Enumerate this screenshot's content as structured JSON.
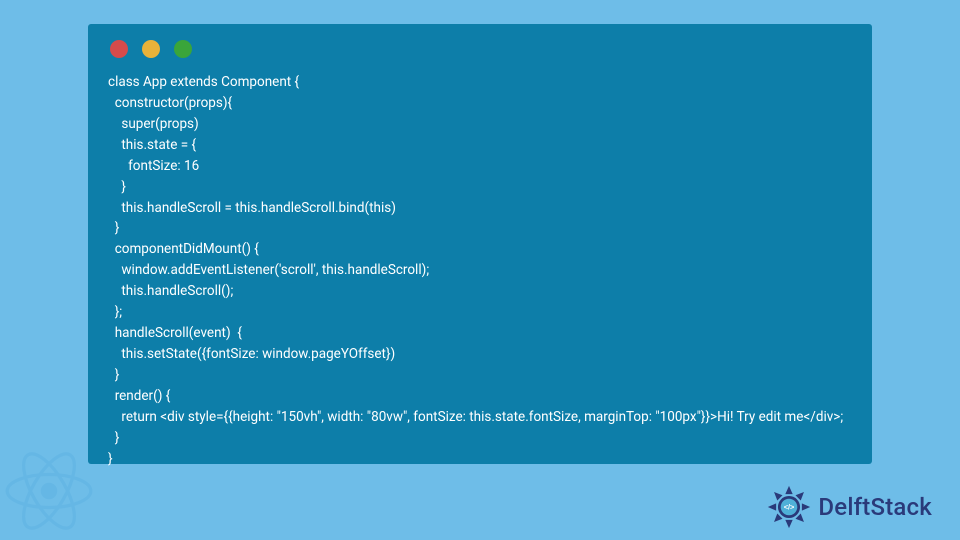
{
  "window": {
    "controls": [
      "close",
      "minimize",
      "zoom"
    ]
  },
  "code_lines": [
    "class App extends Component {",
    "  constructor(props){",
    "    super(props)",
    "    this.state = {",
    "      fontSize: 16",
    "    }",
    "    this.handleScroll = this.handleScroll.bind(this)",
    "  }",
    "  componentDidMount() {",
    "    window.addEventListener('scroll', this.handleScroll);",
    "    this.handleScroll();",
    "  };",
    "  handleScroll(event)  {",
    "    this.setState({fontSize: window.pageYOffset})",
    "  }",
    "  render() {",
    "    return <div style={{height: \"150vh\", width: \"80vw\", fontSize: this.state.fontSize, marginTop: \"100px\"}}>Hi! Try edit me</div>;",
    "  }",
    "}"
  ],
  "brand": {
    "name": "DelftStack"
  }
}
